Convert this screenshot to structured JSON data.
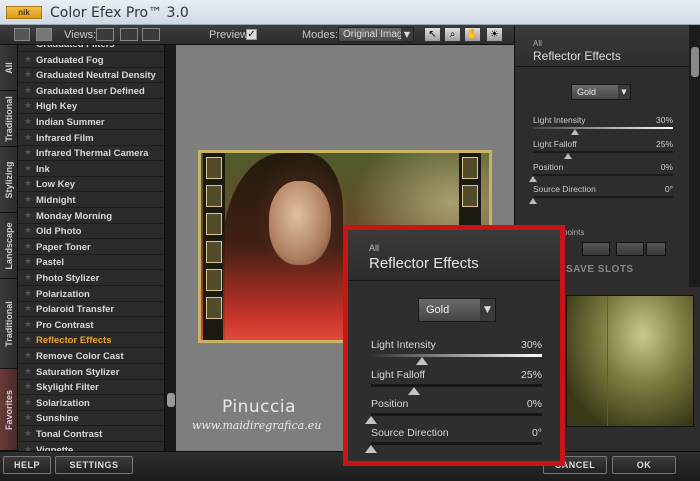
{
  "titlebar": {
    "logo_text": "nik",
    "title": "Color Efex Pro™ 3.0"
  },
  "toolbar": {
    "views_label": "Views:",
    "preview_label": "Preview:",
    "preview_checked": "✓",
    "modes_label": "Modes:",
    "mode_value": "Original Image"
  },
  "tabs": [
    {
      "label": "All"
    },
    {
      "label": "Traditional"
    },
    {
      "label": "Stylizing"
    },
    {
      "label": "Landscape"
    },
    {
      "label": "Traditional"
    },
    {
      "label": "Favorites"
    }
  ],
  "filters": [
    "Graduated Filters",
    "Graduated Fog",
    "Graduated Neutral Density",
    "Graduated User Defined",
    "High Key",
    "Indian Summer",
    "Infrared Film",
    "Infrared Thermal Camera",
    "Ink",
    "Low Key",
    "Midnight",
    "Monday Morning",
    "Old Photo",
    "Paper Toner",
    "Pastel",
    "Photo Stylizer",
    "Polarization",
    "Polaroid Transfer",
    "Pro Contrast",
    "Reflector Effects",
    "Remove Color Cast",
    "Saturation Stylizer",
    "Skylight Filter",
    "Solarization",
    "Sunshine",
    "Tonal Contrast",
    "Vignette"
  ],
  "selected_filter": "Reflector Effects",
  "preview": {
    "signature": "Pinuccia",
    "website": "www.maidiregrafica.eu"
  },
  "panel": {
    "category": "All",
    "title": "Reflector Effects",
    "dropdown_value": "Gold",
    "sliders": [
      {
        "name": "Light Intensity",
        "value": "30%",
        "level": 0.3
      },
      {
        "name": "Light Falloff",
        "value": "25%",
        "level": 0.25
      },
      {
        "name": "Position",
        "value": "0%",
        "level": 0.0
      },
      {
        "name": "Source Direction",
        "value": "0°",
        "level": 0.0
      }
    ],
    "control_points_label": "points",
    "save_slots_label": "SAVE SLOTS"
  },
  "bottom": {
    "help": "HELP",
    "settings": "SETTINGS",
    "cancel": "CANCEL",
    "ok": "OK"
  },
  "colors": {
    "accent_selected": "#f0a020",
    "highlight_border": "#c81414"
  }
}
